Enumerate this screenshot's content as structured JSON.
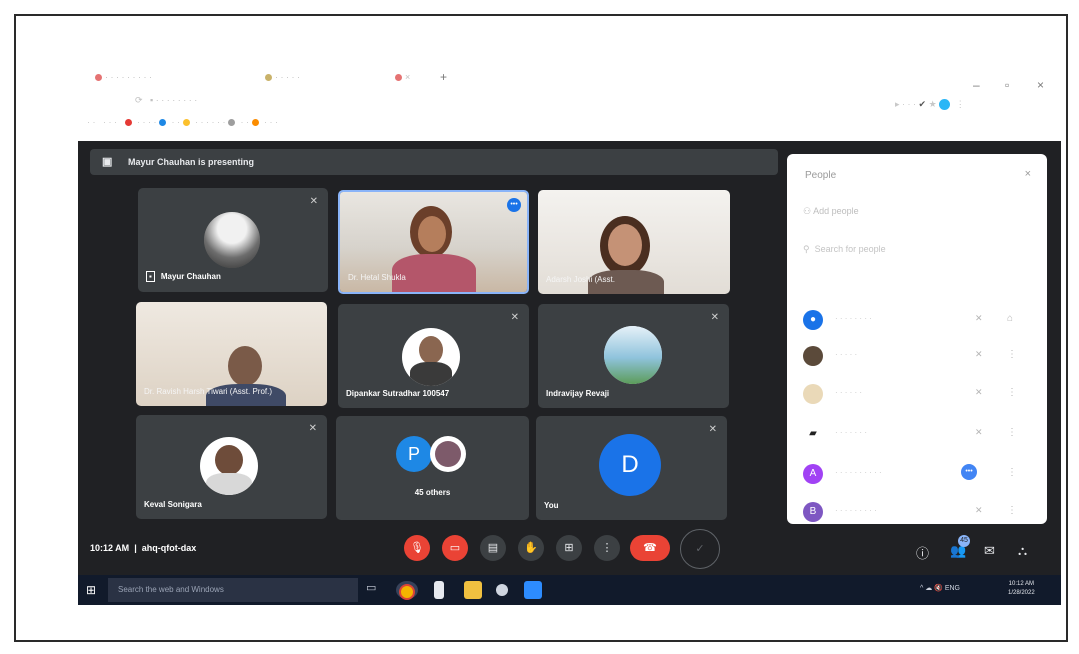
{
  "browser": {
    "window_controls": [
      "–",
      "▫",
      "×"
    ],
    "new_tab": "+"
  },
  "presenting_banner": "Mayur Chauhan is presenting",
  "tiles": [
    {
      "name": "Mayur Chauhan",
      "muted": true
    },
    {
      "name": "Dr. Hetal Shukla",
      "muted": false
    },
    {
      "name": "Adarsh Joshi (Asst.",
      "muted": false
    },
    {
      "name": "Dr. Ravish Harsh Tiwari (Asst. Prof.)",
      "muted": false
    },
    {
      "name": "Dipankar Sutradhar 100547",
      "muted": true
    },
    {
      "name": "Indravijay Revaji",
      "muted": true
    },
    {
      "name": "Keval Sonigara",
      "muted": true
    },
    {
      "name": "45 others",
      "muted": false,
      "avatar_letter": "P"
    },
    {
      "name": "You",
      "muted": true,
      "avatar_letter": "D"
    }
  ],
  "meeting": {
    "time": "10:12 AM",
    "separator": "|",
    "code": "ahq-qfot-dax"
  },
  "people_panel": {
    "title": "People",
    "close_glyph": "×",
    "add_people": "Add people",
    "search_placeholder": "Search for people",
    "participants_count": "45",
    "rows": [
      {
        "initial": "",
        "color": "#1a73e8"
      },
      {
        "initial": "",
        "color": "#5b4a3a"
      },
      {
        "initial": "",
        "color": "#d9c9a8"
      },
      {
        "initial": "",
        "color": "#222222"
      },
      {
        "initial": "A",
        "color": "#a142f4"
      },
      {
        "initial": "B",
        "color": "#7e57c2"
      }
    ]
  },
  "taskbar": {
    "search_placeholder": "Search the web and Windows",
    "clock_time": "10:12 AM",
    "clock_date": "1/28/2022",
    "tray": "^ ☁ 🔇 ENG"
  },
  "colors": {
    "meet_bg": "#202124",
    "tile_bg": "#3c4043",
    "accent_red": "#ea4335",
    "accent_blue": "#1a73e8"
  }
}
